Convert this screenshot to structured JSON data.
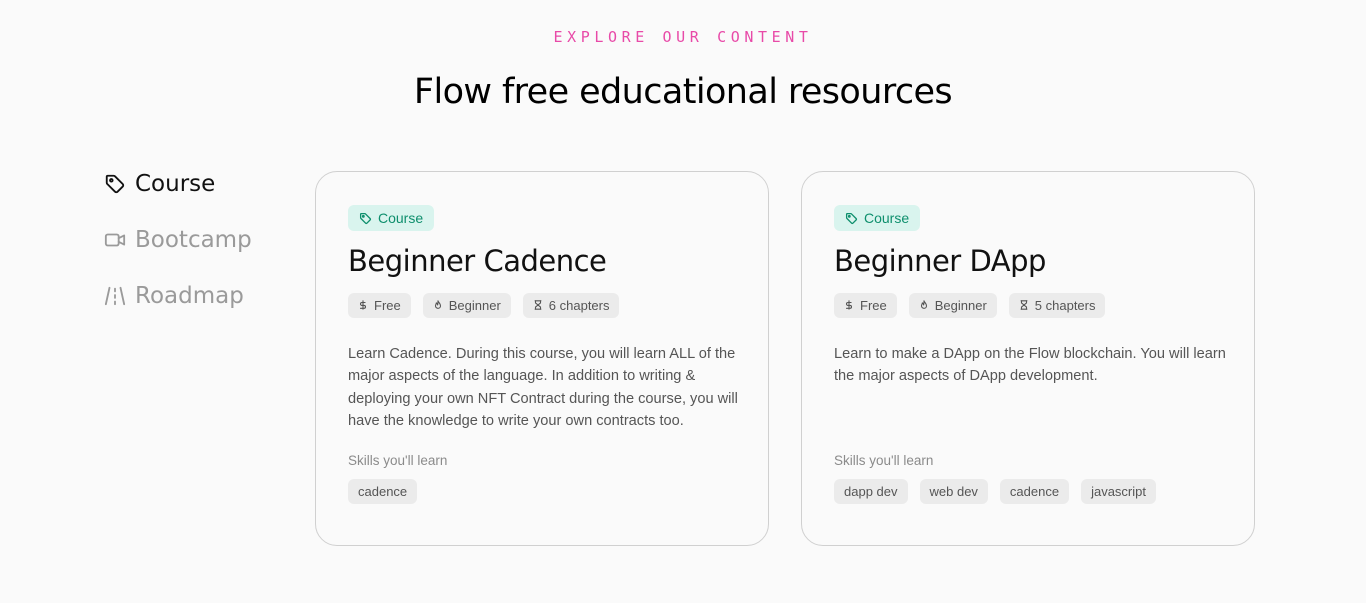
{
  "section": {
    "eyebrow": "EXPLORE OUR CONTENT",
    "title": "Flow free educational resources"
  },
  "sidebar": {
    "items": [
      {
        "label": "Course",
        "icon": "tag-icon",
        "active": true
      },
      {
        "label": "Bootcamp",
        "icon": "video-icon",
        "active": false
      },
      {
        "label": "Roadmap",
        "icon": "road-icon",
        "active": false
      }
    ]
  },
  "cards": [
    {
      "type": "Course",
      "title": "Beginner Cadence",
      "price": "Free",
      "level": "Beginner",
      "chapters": "6 chapters",
      "description": "Learn Cadence. During this course, you will learn ALL of the major aspects of the language. In addition to writing & deploying your own NFT Contract during the course, you will have the knowledge to write your own contracts too.",
      "skills_label": "Skills you'll learn",
      "skills": [
        "cadence"
      ]
    },
    {
      "type": "Course",
      "title": "Beginner DApp",
      "price": "Free",
      "level": "Beginner",
      "chapters": "5 chapters",
      "description": "Learn to make a DApp on the Flow blockchain. You will learn the major aspects of DApp development.",
      "skills_label": "Skills you'll learn",
      "skills": [
        "dapp dev",
        "web dev",
        "cadence",
        "javascript"
      ]
    }
  ],
  "colors": {
    "eyebrow": "#e84aa8",
    "badge_bg": "#d9f4ee",
    "badge_text": "#0e8f6d",
    "chip_bg": "#ebebeb"
  }
}
